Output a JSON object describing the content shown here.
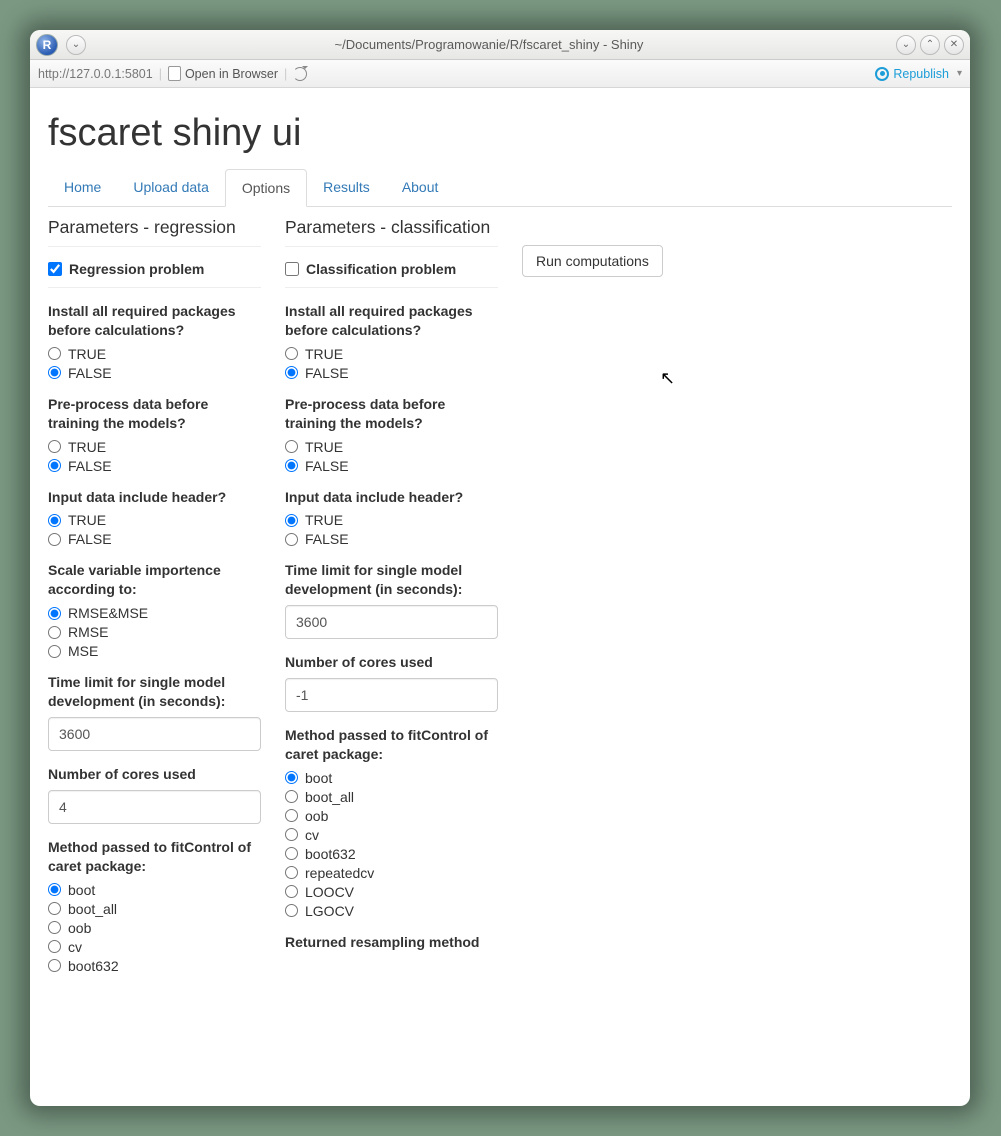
{
  "window": {
    "title": "~/Documents/Programowanie/R/fscaret_shiny - Shiny"
  },
  "toolbar": {
    "url": "http://127.0.0.1:5801",
    "open_in_browser": "Open in Browser",
    "republish": "Republish"
  },
  "page": {
    "h1": "fscaret shiny ui"
  },
  "tabs": {
    "home": "Home",
    "upload": "Upload data",
    "options": "Options",
    "results": "Results",
    "about": "About"
  },
  "reg": {
    "title": "Parameters - regression",
    "problem": "Regression problem",
    "install": {
      "label": "Install all required packages before calculations?",
      "true": "TRUE",
      "false": "FALSE"
    },
    "preproc": {
      "label": "Pre-process data before training the models?",
      "true": "TRUE",
      "false": "FALSE"
    },
    "header": {
      "label": "Input data include header?",
      "true": "TRUE",
      "false": "FALSE"
    },
    "scale": {
      "label": "Scale variable importence according to:",
      "o1": "RMSE&MSE",
      "o2": "RMSE",
      "o3": "MSE"
    },
    "time": {
      "label": "Time limit for single model development (in seconds):",
      "value": "3600"
    },
    "cores": {
      "label": "Number of cores used",
      "value": "4"
    },
    "fit": {
      "label": "Method passed to fitControl of caret package:",
      "o1": "boot",
      "o2": "boot_all",
      "o3": "oob",
      "o4": "cv",
      "o5": "boot632"
    }
  },
  "cls": {
    "title": "Parameters - classification",
    "problem": "Classification problem",
    "install": {
      "label": "Install all required packages before calculations?",
      "true": "TRUE",
      "false": "FALSE"
    },
    "preproc": {
      "label": "Pre-process data before training the models?",
      "true": "TRUE",
      "false": "FALSE"
    },
    "header": {
      "label": "Input data include header?",
      "true": "TRUE",
      "false": "FALSE"
    },
    "time": {
      "label": "Time limit for single model development (in seconds):",
      "value": "3600"
    },
    "cores": {
      "label": "Number of cores used",
      "value": "-1"
    },
    "fit": {
      "label": "Method passed to fitControl of caret package:",
      "o1": "boot",
      "o2": "boot_all",
      "o3": "oob",
      "o4": "cv",
      "o5": "boot632",
      "o6": "repeatedcv",
      "o7": "LOOCV",
      "o8": "LGOCV"
    },
    "resamp": {
      "label": "Returned resampling method"
    }
  },
  "run": {
    "label": "Run computations"
  }
}
